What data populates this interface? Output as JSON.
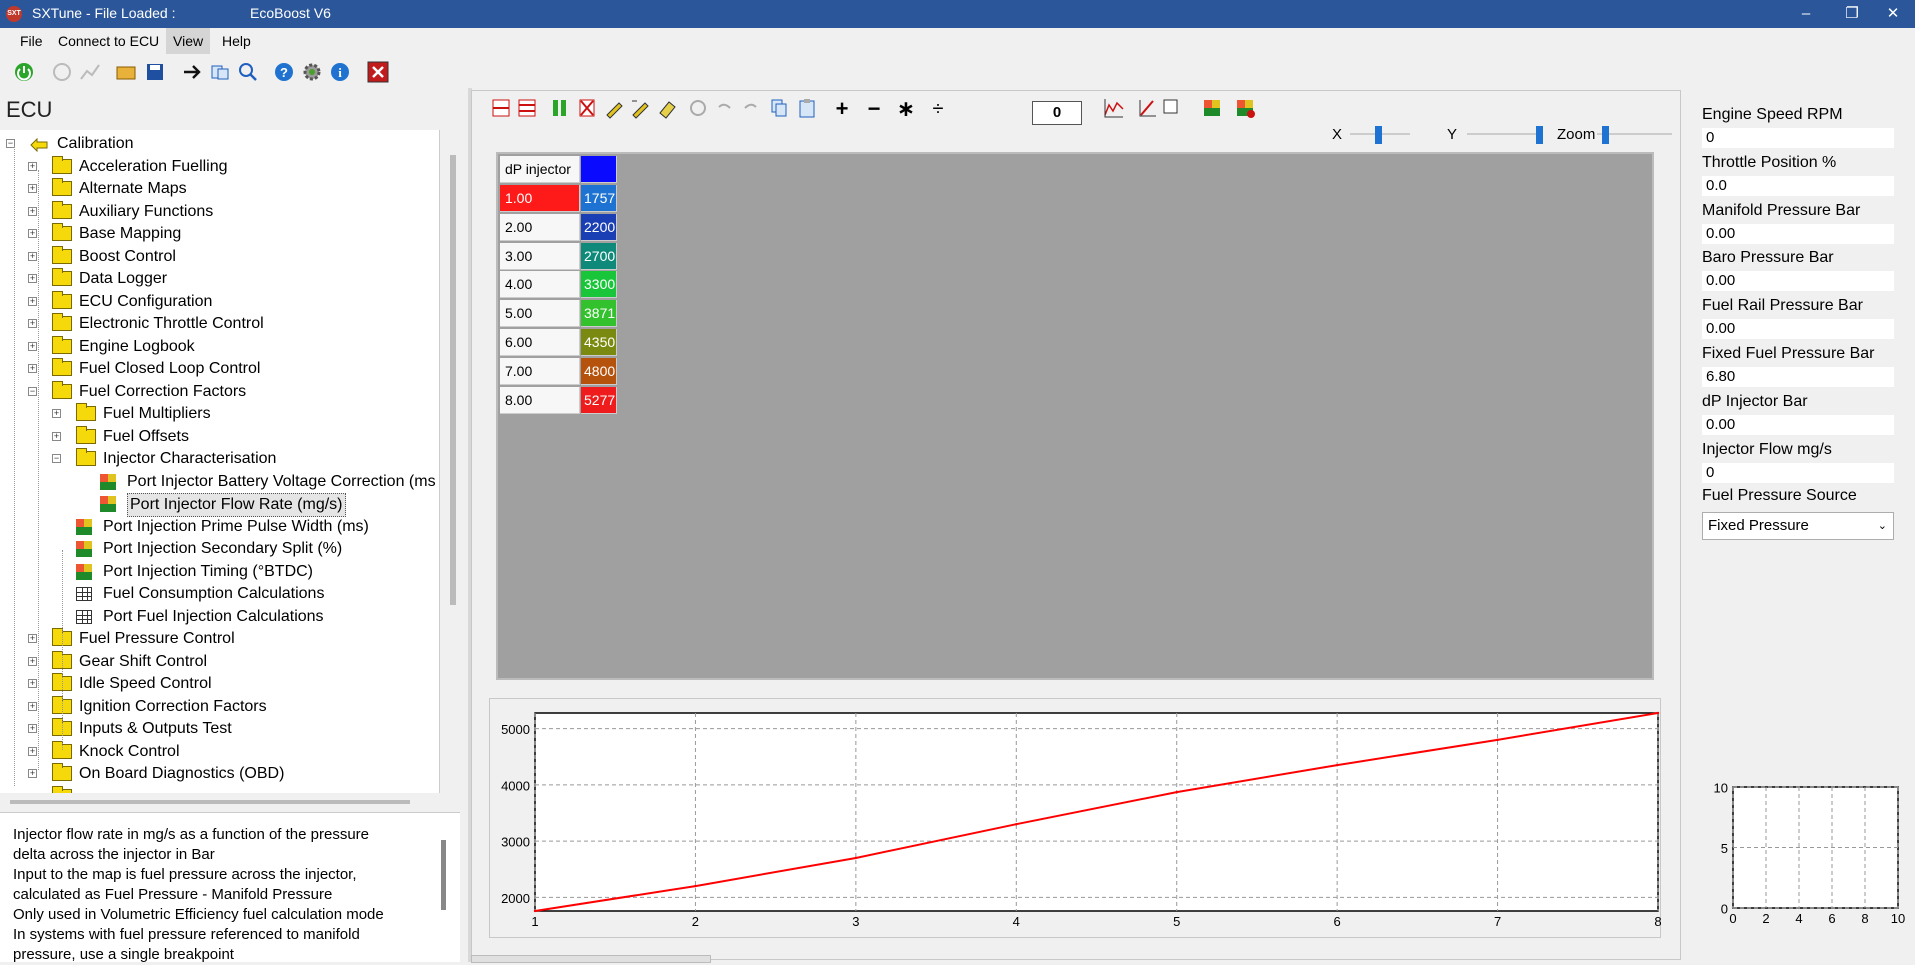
{
  "window": {
    "app_title": "SXTune - File Loaded :",
    "file_name": "EcoBoost V6",
    "app_icon_text": "SXT",
    "minimize": "–",
    "restore": "❐",
    "close": "✕"
  },
  "menu": [
    {
      "label": "File"
    },
    {
      "label": "Connect to ECU"
    },
    {
      "label": "View"
    },
    {
      "label": "Help"
    }
  ],
  "toolbar": {
    "icons": [
      "connect-icon",
      "disconnect-icon",
      "chart-icon",
      "open-icon",
      "save-icon",
      "goto-icon",
      "copy-icon",
      "search-icon",
      "help-icon",
      "settings-icon",
      "info-icon",
      "exit-icon"
    ]
  },
  "ecu": {
    "heading": "ECU",
    "root": "Calibration",
    "folders_top": [
      "Acceleration Fuelling",
      "Alternate Maps",
      "Auxiliary Functions",
      "Base Mapping",
      "Boost Control",
      "Data Logger",
      "ECU Configuration",
      "Electronic Throttle Control",
      "Engine Logbook",
      "Fuel Closed Loop Control",
      "Fuel Correction Factors"
    ],
    "fcf_children": {
      "fuel_multipliers": "Fuel Multipliers",
      "fuel_offsets": "Fuel Offsets",
      "injector_char": "Injector Characterisation",
      "inj_battery": "Port Injector Battery Voltage Correction (ms",
      "inj_flow": "Port Injector Flow Rate (mg/s)",
      "prime_pulse": "Port Injection Prime Pulse Width (ms)",
      "secondary_split": "Port Injection Secondary Split (%)",
      "timing": "Port Injection Timing (°BTDC)",
      "consumption": "Fuel Consumption Calculations",
      "port_fuel_calc": "Port Fuel Injection Calculations"
    },
    "folders_bottom": [
      "Fuel Pressure Control",
      "Gear Shift Control",
      "Idle Speed Control",
      "Ignition Correction Factors",
      "Inputs & Outputs Test",
      "Knock Control",
      "On Board Diagnostics (OBD)"
    ]
  },
  "description": [
    "Injector flow rate in mg/s as a function of the pressure",
    "delta across the injector in Bar",
    "Input to the map is fuel pressure across the injector,",
    "calculated as Fuel Pressure - Manifold Pressure",
    "Only used in Volumetric Efficiency fuel calculation mode",
    "In systems with fuel pressure referenced to manifold",
    "pressure, use a single breakpoint"
  ],
  "table_toolbar": {
    "value_input": "0",
    "x_label": "X",
    "y_label": "Y",
    "zoom_label": "Zoom",
    "ops": [
      "+",
      "−",
      "∗",
      "÷"
    ]
  },
  "table": {
    "header": "dP injector",
    "header_color": "#0a0aff",
    "rows": [
      {
        "dp": "1.00",
        "flow": "1757",
        "color": "#1e73d2"
      },
      {
        "dp": "2.00",
        "flow": "2200",
        "color": "#1a3fb5"
      },
      {
        "dp": "3.00",
        "flow": "2700",
        "color": "#0f8a7a"
      },
      {
        "dp": "4.00",
        "flow": "3300",
        "color": "#19c63a"
      },
      {
        "dp": "5.00",
        "flow": "3871",
        "color": "#33c22d"
      },
      {
        "dp": "6.00",
        "flow": "4350",
        "color": "#7a8a10"
      },
      {
        "dp": "7.00",
        "flow": "4800",
        "color": "#b5530d"
      },
      {
        "dp": "8.00",
        "flow": "5277",
        "color": "#ee1c1c"
      }
    ],
    "selected_row_color": "#ff1a1a"
  },
  "chart_data": [
    {
      "type": "line",
      "x": [
        1,
        2,
        3,
        4,
        5,
        6,
        7,
        8
      ],
      "series": [
        {
          "values": [
            1757,
            2200,
            2700,
            3300,
            3871,
            4350,
            4800,
            5277
          ],
          "color": "#ff0000"
        }
      ],
      "xlim": [
        1,
        8
      ],
      "ylim": [
        1757,
        5277
      ],
      "x_ticks": [
        1,
        2,
        3,
        4,
        5,
        6,
        7,
        8
      ],
      "y_ticks": [
        2000,
        3000,
        4000,
        5000
      ],
      "grid": true
    },
    {
      "type": "line",
      "x": [],
      "series": [],
      "xlim": [
        0,
        10
      ],
      "ylim": [
        0,
        10
      ],
      "x_ticks": [
        0,
        2,
        4,
        6,
        8,
        10
      ],
      "y_ticks": [
        0,
        5,
        10
      ],
      "grid": true
    }
  ],
  "live": {
    "fields": [
      {
        "label": "Engine Speed RPM",
        "value": "0"
      },
      {
        "label": "Throttle Position %",
        "value": "0.0"
      },
      {
        "label": "Manifold Pressure Bar",
        "value": "0.00"
      },
      {
        "label": "Baro Pressure Bar",
        "value": "0.00"
      },
      {
        "label": "Fuel Rail Pressure Bar",
        "value": "0.00"
      },
      {
        "label": "Fixed Fuel Pressure Bar",
        "value": "6.80"
      },
      {
        "label": "dP Injector Bar",
        "value": "0.00"
      },
      {
        "label": "Injector Flow mg/s",
        "value": "0"
      }
    ],
    "source_label": "Fuel Pressure Source",
    "source_value": "Fixed Pressure"
  }
}
